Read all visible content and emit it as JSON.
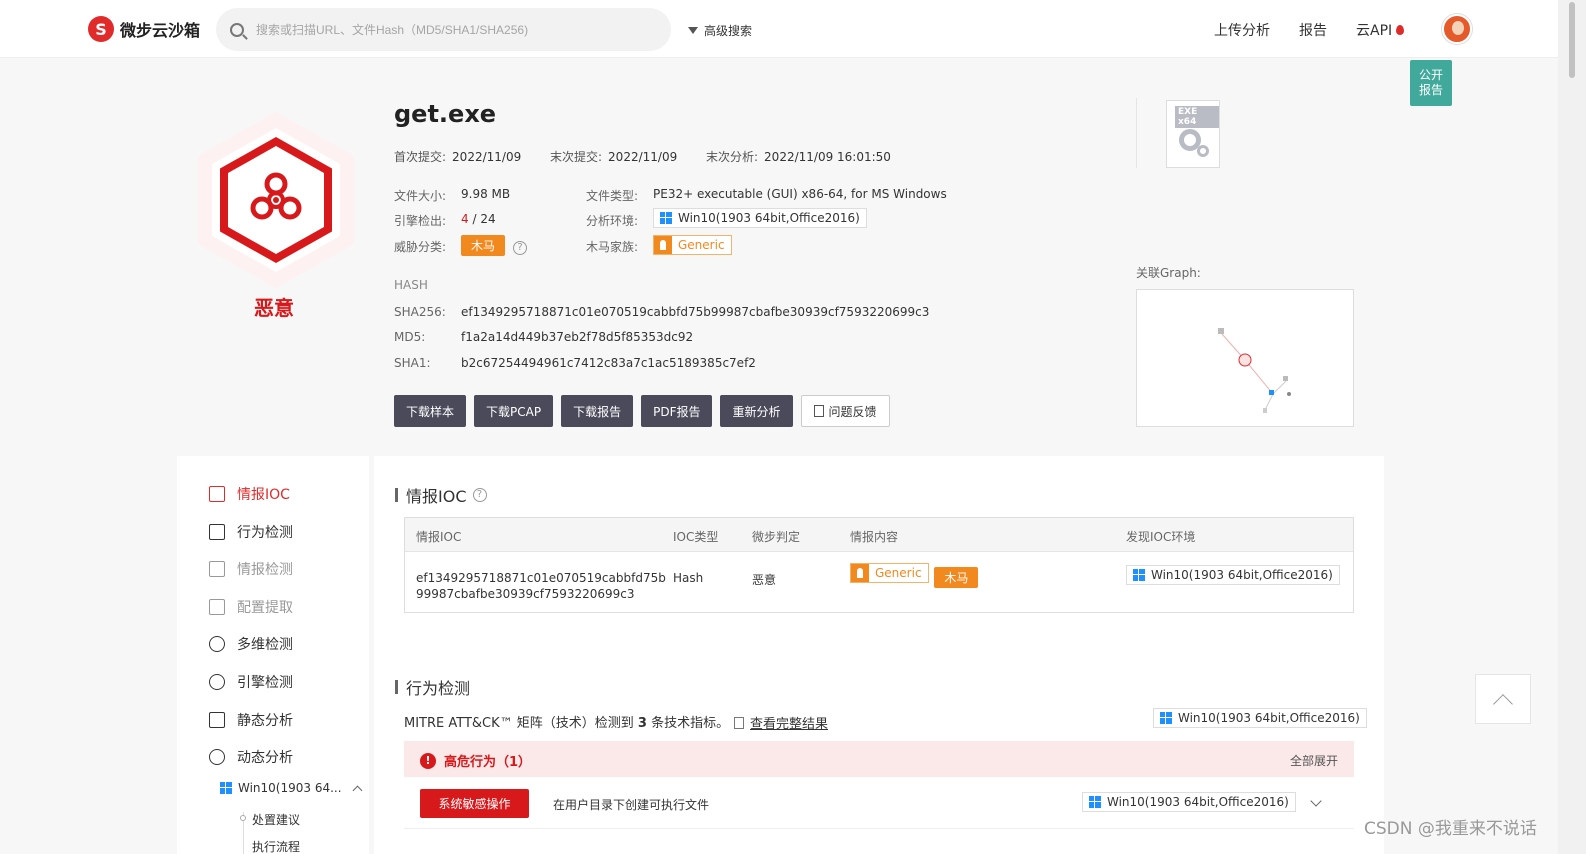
{
  "header": {
    "logo_text": "微步云沙箱",
    "logo_mark": "S",
    "search_placeholder": "搜索或扫描URL、文件Hash（MD5/SHA1/SHA256)",
    "advanced_search": "高级搜索",
    "nav": [
      "上传分析",
      "报告",
      "云API"
    ]
  },
  "public_report": [
    "公开",
    "报告"
  ],
  "verdict": {
    "label": "恶意",
    "color": "#d7191c"
  },
  "file": {
    "name": "get.exe",
    "first_submit_label": "首次提交:",
    "first_submit": "2022/11/09",
    "last_submit_label": "末次提交:",
    "last_submit": "2022/11/09",
    "last_analysis_label": "末次分析:",
    "last_analysis": "2022/11/09 16:01:50",
    "size_label": "文件大小:",
    "size": "9.98 MB",
    "engine_label": "引擎检出:",
    "engine_hits": "4",
    "engine_total": " / 24",
    "threat_label": "威胁分类:",
    "threat": "木马",
    "type_label": "文件类型:",
    "type": "PE32+ executable (GUI) x86-64, for MS Windows",
    "env_label": "分析环境:",
    "env": "Win10(1903 64bit,Office2016)",
    "family_label": "木马家族:",
    "family": "Generic",
    "icon_badge": "EXE x64"
  },
  "hash": {
    "section": "HASH",
    "sha256_label": "SHA256:",
    "sha256": "ef1349295718871c01e070519cabbfd75b99987cbafbe30939cf7593220699c3",
    "md5_label": "MD5:",
    "md5": "f1a2a14d449b37eb2f78d5f85353dc92",
    "sha1_label": "SHA1:",
    "sha1": "b2c67254494961c7412c83a7c1ac5189385c7ef2"
  },
  "actions": [
    "下载样本",
    "下载PCAP",
    "下载报告",
    "PDF报告",
    "重新分析",
    "问题反馈"
  ],
  "graph_label": "关联Graph:",
  "sidebar": {
    "items": [
      "情报IOC",
      "行为检测",
      "情报检测",
      "配置提取",
      "多维检测",
      "引擎检测",
      "静态分析",
      "动态分析"
    ],
    "env_sub": "Win10(1903 64...",
    "sub_items": [
      "处置建议",
      "执行流程"
    ]
  },
  "ioc": {
    "title": "情报IOC",
    "columns": [
      "情报IOC",
      "IOC类型",
      "微步判定",
      "情报内容",
      "发现IOC环境"
    ],
    "row": {
      "ioc_line1": "ef1349295718871c01e070519cabbfd75b",
      "ioc_line2": "99987cbafbe30939cf7593220699c3",
      "type": "Hash",
      "verdict": "恶意",
      "family": "Generic",
      "category": "木马",
      "env": "Win10(1903 64bit,Office2016)"
    }
  },
  "behavior": {
    "title": "行为检测",
    "mitre_prefix": "MITRE ATT&CK™ 矩阵（技术）检测到 ",
    "mitre_count": "3",
    "mitre_suffix": " 条技术指标。",
    "view_full": "查看完整结果",
    "env": "Win10(1903 64bit,Office2016)",
    "risk_title": "高危行为（1）",
    "expand_all": "全部展开",
    "item_tag": "系统敏感操作",
    "item_desc": "在用户目录下创建可执行文件",
    "item_env": "Win10(1903 64bit,Office2016)"
  },
  "watermark": "CSDN @我重来不说话"
}
